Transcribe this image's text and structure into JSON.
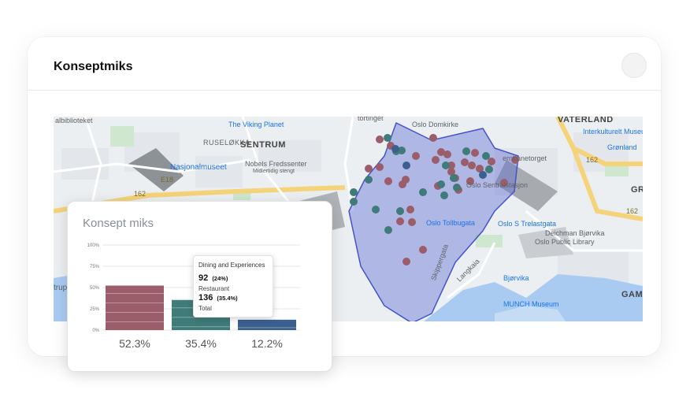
{
  "card": {
    "title": "Konseptmiks"
  },
  "map": {
    "labels": {
      "albibliotek": "albiblioteket",
      "viking": "The Viking Planet",
      "domkirke": "Oslo Domkirke",
      "vaterland": "VATERLAND",
      "interkultur": "Interkulturelt Museum",
      "gronland": "Grønland",
      "ruselokka": "RUSELØKKA",
      "sentrum": "SENTRUM",
      "nobels": "Nobels Fredssenter",
      "midlertidig": "Midlertidig stengt",
      "nasjonal": "Nasjonalmuseet",
      "jernbane": "ernbanetorget",
      "sentralst": "Oslo Sentralstasjon",
      "tollbu": "Oslo Tollbugata",
      "trelast": "Oslo S Trelastgata",
      "deichman": "Deichman Bjørvika",
      "publib": "Oslo Public Library",
      "bjorvika": "Bjørvika",
      "munch": "MUNCH Museum",
      "gam": "GAM",
      "gr": "GR",
      "e18": "E18",
      "r162a": "162",
      "r162b": "162",
      "r162c": "162",
      "stortinget": "tortinget",
      "langkaia": "Langkaia",
      "skippergata": "Skippergata",
      "trup": "trup"
    }
  },
  "chart_card": {
    "title": "Konsept miks"
  },
  "chart_data": {
    "type": "bar",
    "title": "Konsept miks",
    "categories": [
      "",
      "",
      ""
    ],
    "values": [
      52.3,
      35.4,
      12.2
    ],
    "colors": [
      "#9b5d6a",
      "#3f7b78",
      "#3b5f8f"
    ],
    "ylim": [
      0,
      100
    ],
    "yticks": [
      "0%",
      "25%",
      "50%",
      "75%",
      "100%"
    ],
    "bar_labels": [
      "52.3%",
      "35.4%",
      "12.2%"
    ]
  },
  "tooltip": {
    "title": "Dining and Experiences",
    "val1": "92",
    "pct1": "(24%)",
    "label1": "Restaurant",
    "val2": "136",
    "pct2": "(35.4%)",
    "label2": "Total"
  }
}
